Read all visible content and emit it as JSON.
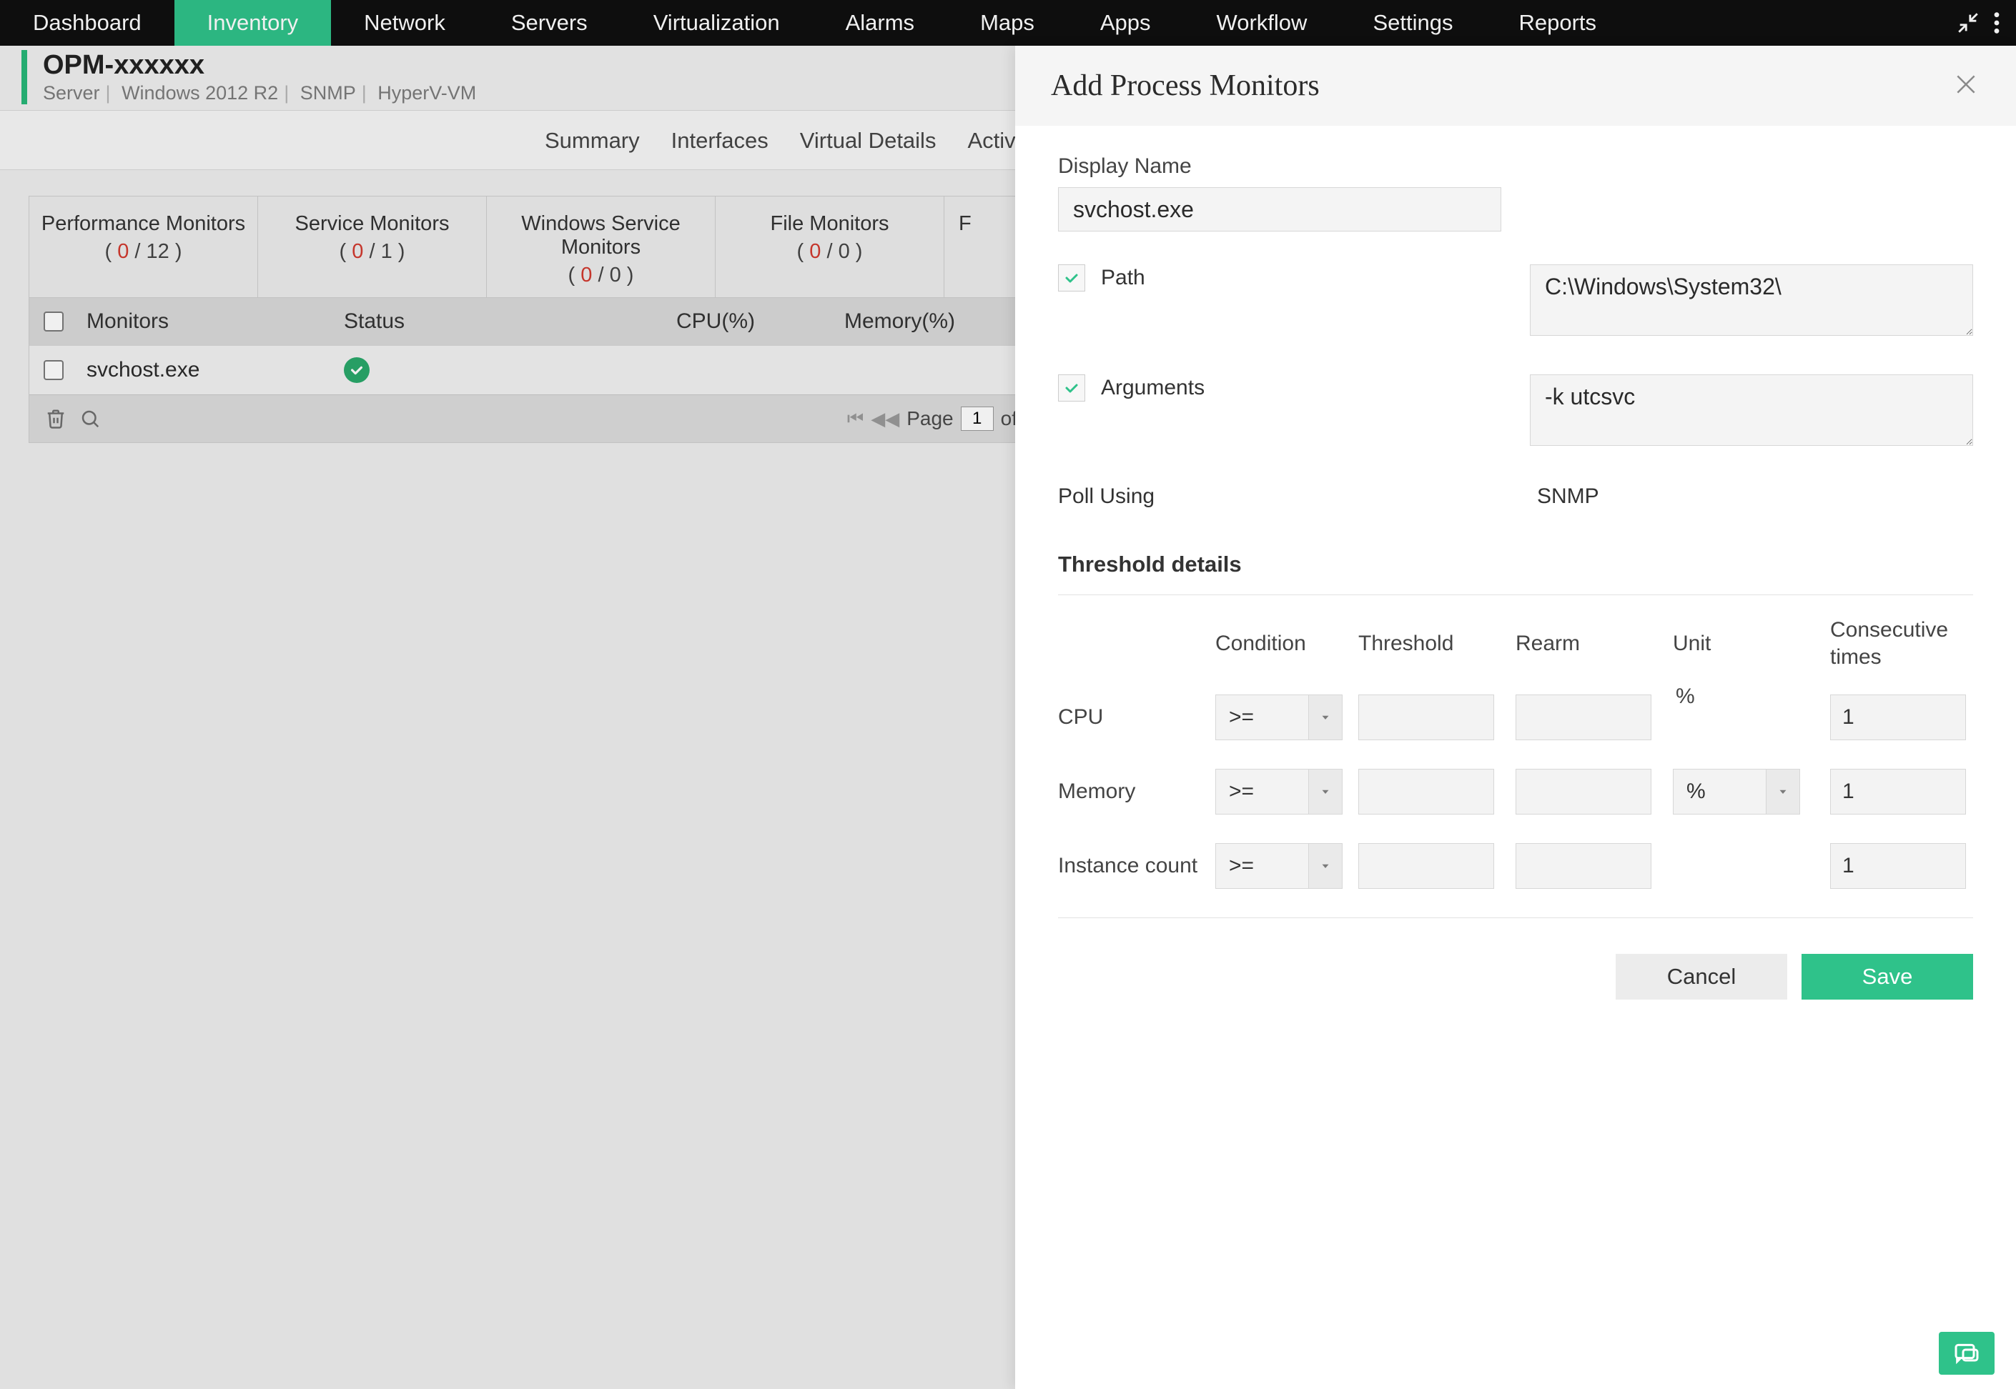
{
  "nav": {
    "items": [
      "Dashboard",
      "Inventory",
      "Network",
      "Servers",
      "Virtualization",
      "Alarms",
      "Maps",
      "Apps",
      "Workflow",
      "Settings",
      "Reports"
    ],
    "active_index": 1
  },
  "header": {
    "title": "OPM-xxxxxx",
    "crumbs": [
      "Server",
      "Windows 2012 R2",
      "SNMP",
      "HyperV-VM"
    ]
  },
  "sec_tabs": [
    "Summary",
    "Interfaces",
    "Virtual Details",
    "Active P…"
  ],
  "monitor_tabs": [
    {
      "label": "Performance Monitors",
      "n1": "0",
      "n2": "12"
    },
    {
      "label": "Service Monitors",
      "n1": "0",
      "n2": "1"
    },
    {
      "label": "Windows Service Monitors",
      "n1": "0",
      "n2": "0"
    },
    {
      "label": "File Monitors",
      "n1": "0",
      "n2": "0"
    }
  ],
  "cut_tab_letter": "F",
  "table": {
    "headers": {
      "monitors": "Monitors",
      "status": "Status",
      "cpu": "CPU(%)",
      "mem": "Memory(%)"
    },
    "rows": [
      {
        "name": "svchost.exe"
      }
    ],
    "pager": {
      "page_label": "Page",
      "of_label": "of",
      "page": "1"
    }
  },
  "panel": {
    "title": "Add Process Monitors",
    "display_name_label": "Display Name",
    "display_name": "svchost.exe",
    "path_label": "Path",
    "path": "C:\\Windows\\System32\\",
    "args_label": "Arguments",
    "args": "-k utcsvc",
    "poll_label": "Poll Using",
    "poll_value": "SNMP",
    "threshold_title": "Threshold details",
    "th_headers": {
      "cond": "Condition",
      "thr": "Threshold",
      "rearm": "Rearm",
      "unit": "Unit",
      "cons": "Consecutive times"
    },
    "rows": {
      "cpu": {
        "label": "CPU",
        "cond": ">=",
        "thr": "",
        "rearm": "",
        "unit": "%",
        "cons": "1",
        "unit_is_select": false
      },
      "mem": {
        "label": "Memory",
        "cond": ">=",
        "thr": "",
        "rearm": "",
        "unit": "%",
        "cons": "1",
        "unit_is_select": true
      },
      "inst": {
        "label": "Instance count",
        "cond": ">=",
        "thr": "",
        "rearm": "",
        "unit": "",
        "cons": "1",
        "unit_is_select": false
      }
    },
    "buttons": {
      "cancel": "Cancel",
      "save": "Save"
    }
  }
}
